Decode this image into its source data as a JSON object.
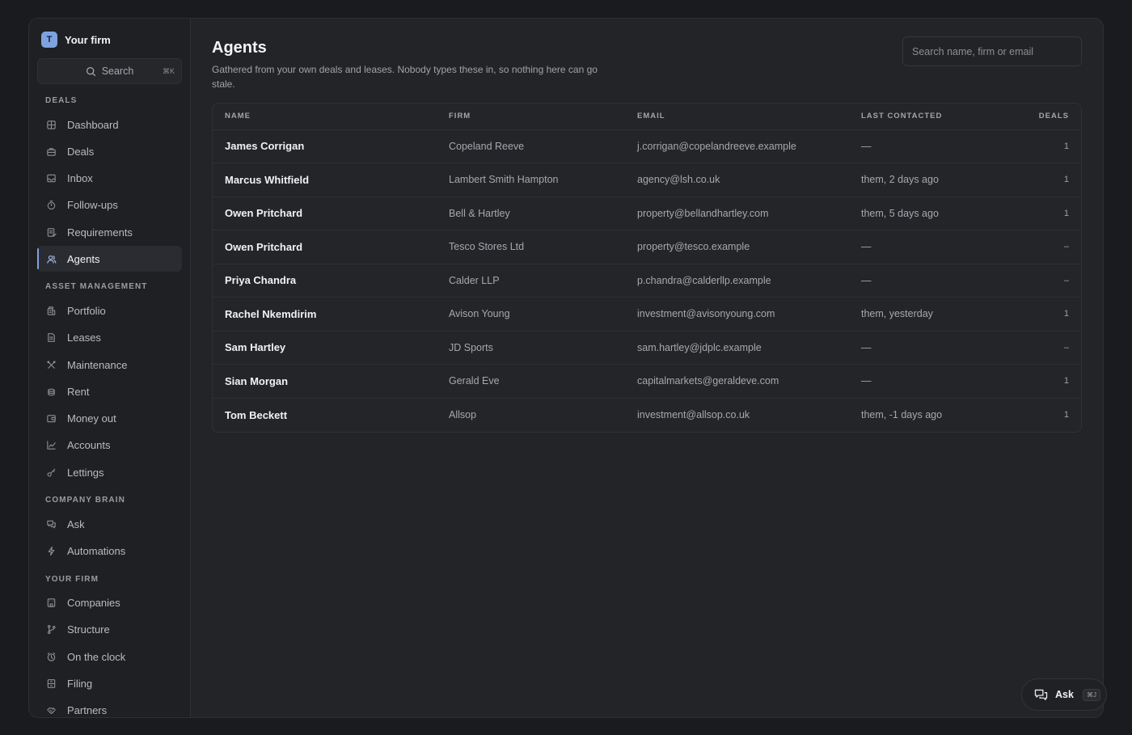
{
  "brand": {
    "initial": "T",
    "name": "Your firm"
  },
  "sidebar": {
    "search_label": "Search",
    "search_shortcut": "⌘K",
    "sections": [
      {
        "label": "DEALS",
        "items": [
          {
            "label": "Dashboard",
            "icon": "dashboard-icon"
          },
          {
            "label": "Deals",
            "icon": "briefcase-icon"
          },
          {
            "label": "Inbox",
            "icon": "inbox-icon"
          },
          {
            "label": "Follow-ups",
            "icon": "timer-icon"
          },
          {
            "label": "Requirements",
            "icon": "checklist-icon"
          },
          {
            "label": "Agents",
            "icon": "people-icon",
            "active": true
          }
        ]
      },
      {
        "label": "ASSET MANAGEMENT",
        "items": [
          {
            "label": "Portfolio",
            "icon": "building-icon"
          },
          {
            "label": "Leases",
            "icon": "document-icon"
          },
          {
            "label": "Maintenance",
            "icon": "tools-icon"
          },
          {
            "label": "Rent",
            "icon": "coins-icon"
          },
          {
            "label": "Money out",
            "icon": "wallet-icon"
          },
          {
            "label": "Accounts",
            "icon": "chart-icon"
          },
          {
            "label": "Lettings",
            "icon": "key-icon"
          }
        ]
      },
      {
        "label": "COMPANY BRAIN",
        "items": [
          {
            "label": "Ask",
            "icon": "chat-icon"
          },
          {
            "label": "Automations",
            "icon": "bolt-icon"
          }
        ]
      },
      {
        "label": "YOUR FIRM",
        "items": [
          {
            "label": "Companies",
            "icon": "office-icon"
          },
          {
            "label": "Structure",
            "icon": "branch-icon"
          },
          {
            "label": "On the clock",
            "icon": "clock-icon"
          },
          {
            "label": "Filing",
            "icon": "cabinet-icon"
          },
          {
            "label": "Partners",
            "icon": "handshake-icon"
          }
        ]
      }
    ]
  },
  "page": {
    "title": "Agents",
    "subtitle": "Gathered from your own deals and leases. Nobody types these in, so nothing here can go stale.",
    "search_placeholder": "Search name, firm or email"
  },
  "table": {
    "columns": [
      "NAME",
      "FIRM",
      "EMAIL",
      "LAST CONTACTED",
      "DEALS"
    ],
    "rows": [
      {
        "name": "James Corrigan",
        "firm": "Copeland Reeve",
        "email": "j.corrigan@copelandreeve.example",
        "last_contacted": "—",
        "deals": "1"
      },
      {
        "name": "Marcus Whitfield",
        "firm": "Lambert Smith Hampton",
        "email": "agency@lsh.co.uk",
        "last_contacted": "them, 2 days ago",
        "deals": "1"
      },
      {
        "name": "Owen Pritchard",
        "firm": "Bell & Hartley",
        "email": "property@bellandhartley.com",
        "last_contacted": "them, 5 days ago",
        "deals": "1"
      },
      {
        "name": "Owen Pritchard",
        "firm": "Tesco Stores Ltd",
        "email": "property@tesco.example",
        "last_contacted": "—",
        "deals": "–"
      },
      {
        "name": "Priya Chandra",
        "firm": "Calder LLP",
        "email": "p.chandra@calderllp.example",
        "last_contacted": "—",
        "deals": "–"
      },
      {
        "name": "Rachel Nkemdirim",
        "firm": "Avison Young",
        "email": "investment@avisonyoung.com",
        "last_contacted": "them, yesterday",
        "deals": "1"
      },
      {
        "name": "Sam Hartley",
        "firm": "JD Sports",
        "email": "sam.hartley@jdplc.example",
        "last_contacted": "—",
        "deals": "–"
      },
      {
        "name": "Sian Morgan",
        "firm": "Gerald Eve",
        "email": "capitalmarkets@geraldeve.com",
        "last_contacted": "—",
        "deals": "1"
      },
      {
        "name": "Tom Beckett",
        "firm": "Allsop",
        "email": "investment@allsop.co.uk",
        "last_contacted": "them, -1 days ago",
        "deals": "1"
      }
    ]
  },
  "ask_button": {
    "label": "Ask",
    "shortcut": "⌘J"
  },
  "colors": {
    "accent": "#7ea2e0",
    "background": "#1a1b1e",
    "surface": "#232427",
    "sidebar": "#1f2023"
  }
}
